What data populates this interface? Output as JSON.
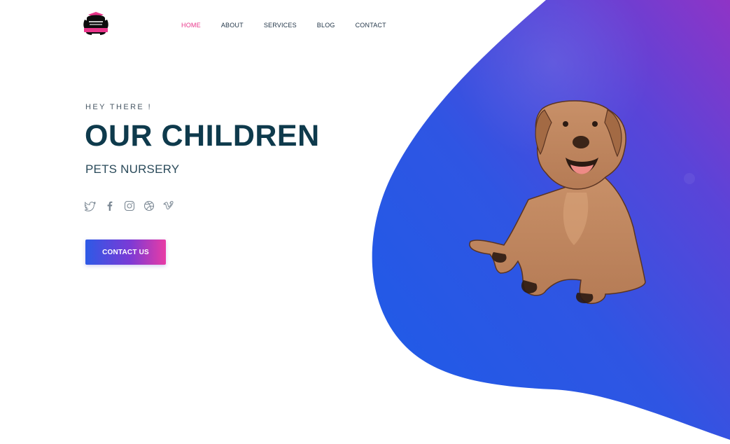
{
  "logo": {
    "name": "Our Children Pets Nursery logo",
    "top_text": "OUR CHILDREN",
    "bottom_text": "PETS NURSERY"
  },
  "nav": {
    "items": [
      {
        "label": "HOME",
        "active": true
      },
      {
        "label": "ABOUT",
        "active": false
      },
      {
        "label": "SERVICES",
        "active": false
      },
      {
        "label": "BLOG",
        "active": false
      },
      {
        "label": "CONTACT",
        "active": false
      }
    ]
  },
  "hero": {
    "greeting": "HEY THERE !",
    "title": "OUR CHILDREN",
    "subtitle": "PETS NURSERY",
    "cta_label": "CONTACT US"
  },
  "social": [
    "twitter-icon",
    "facebook-icon",
    "instagram-icon",
    "dribbble-icon",
    "vimeo-icon"
  ],
  "colors": {
    "accent_pink": "#e8358a",
    "title_dark": "#0e3a4c",
    "gradient_blue": "#2157e6",
    "gradient_purple": "#8a33c9"
  }
}
